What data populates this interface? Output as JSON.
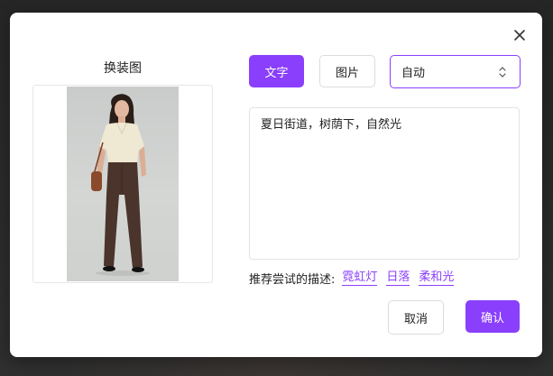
{
  "dialog": {
    "close_icon": "close-icon",
    "left_panel": {
      "title": "换装图",
      "image_alt": "woman-in-cream-shirt-and-brown-trousers"
    },
    "mode_tabs": [
      {
        "label": "文字",
        "active": true
      },
      {
        "label": "图片",
        "active": false
      }
    ],
    "select": {
      "value": "自动",
      "icon": "chevron-updown-icon"
    },
    "prompt": {
      "value": "夏日街道，树荫下，自然光"
    },
    "suggestions": {
      "label": "推荐尝试的描述:",
      "items": [
        "霓虹灯",
        "日落",
        "柔和光"
      ]
    },
    "buttons": {
      "cancel": "取消",
      "confirm": "确认"
    }
  },
  "colors": {
    "accent": "#8a3ffc",
    "border": "#dcdcdc",
    "text": "#222222"
  }
}
